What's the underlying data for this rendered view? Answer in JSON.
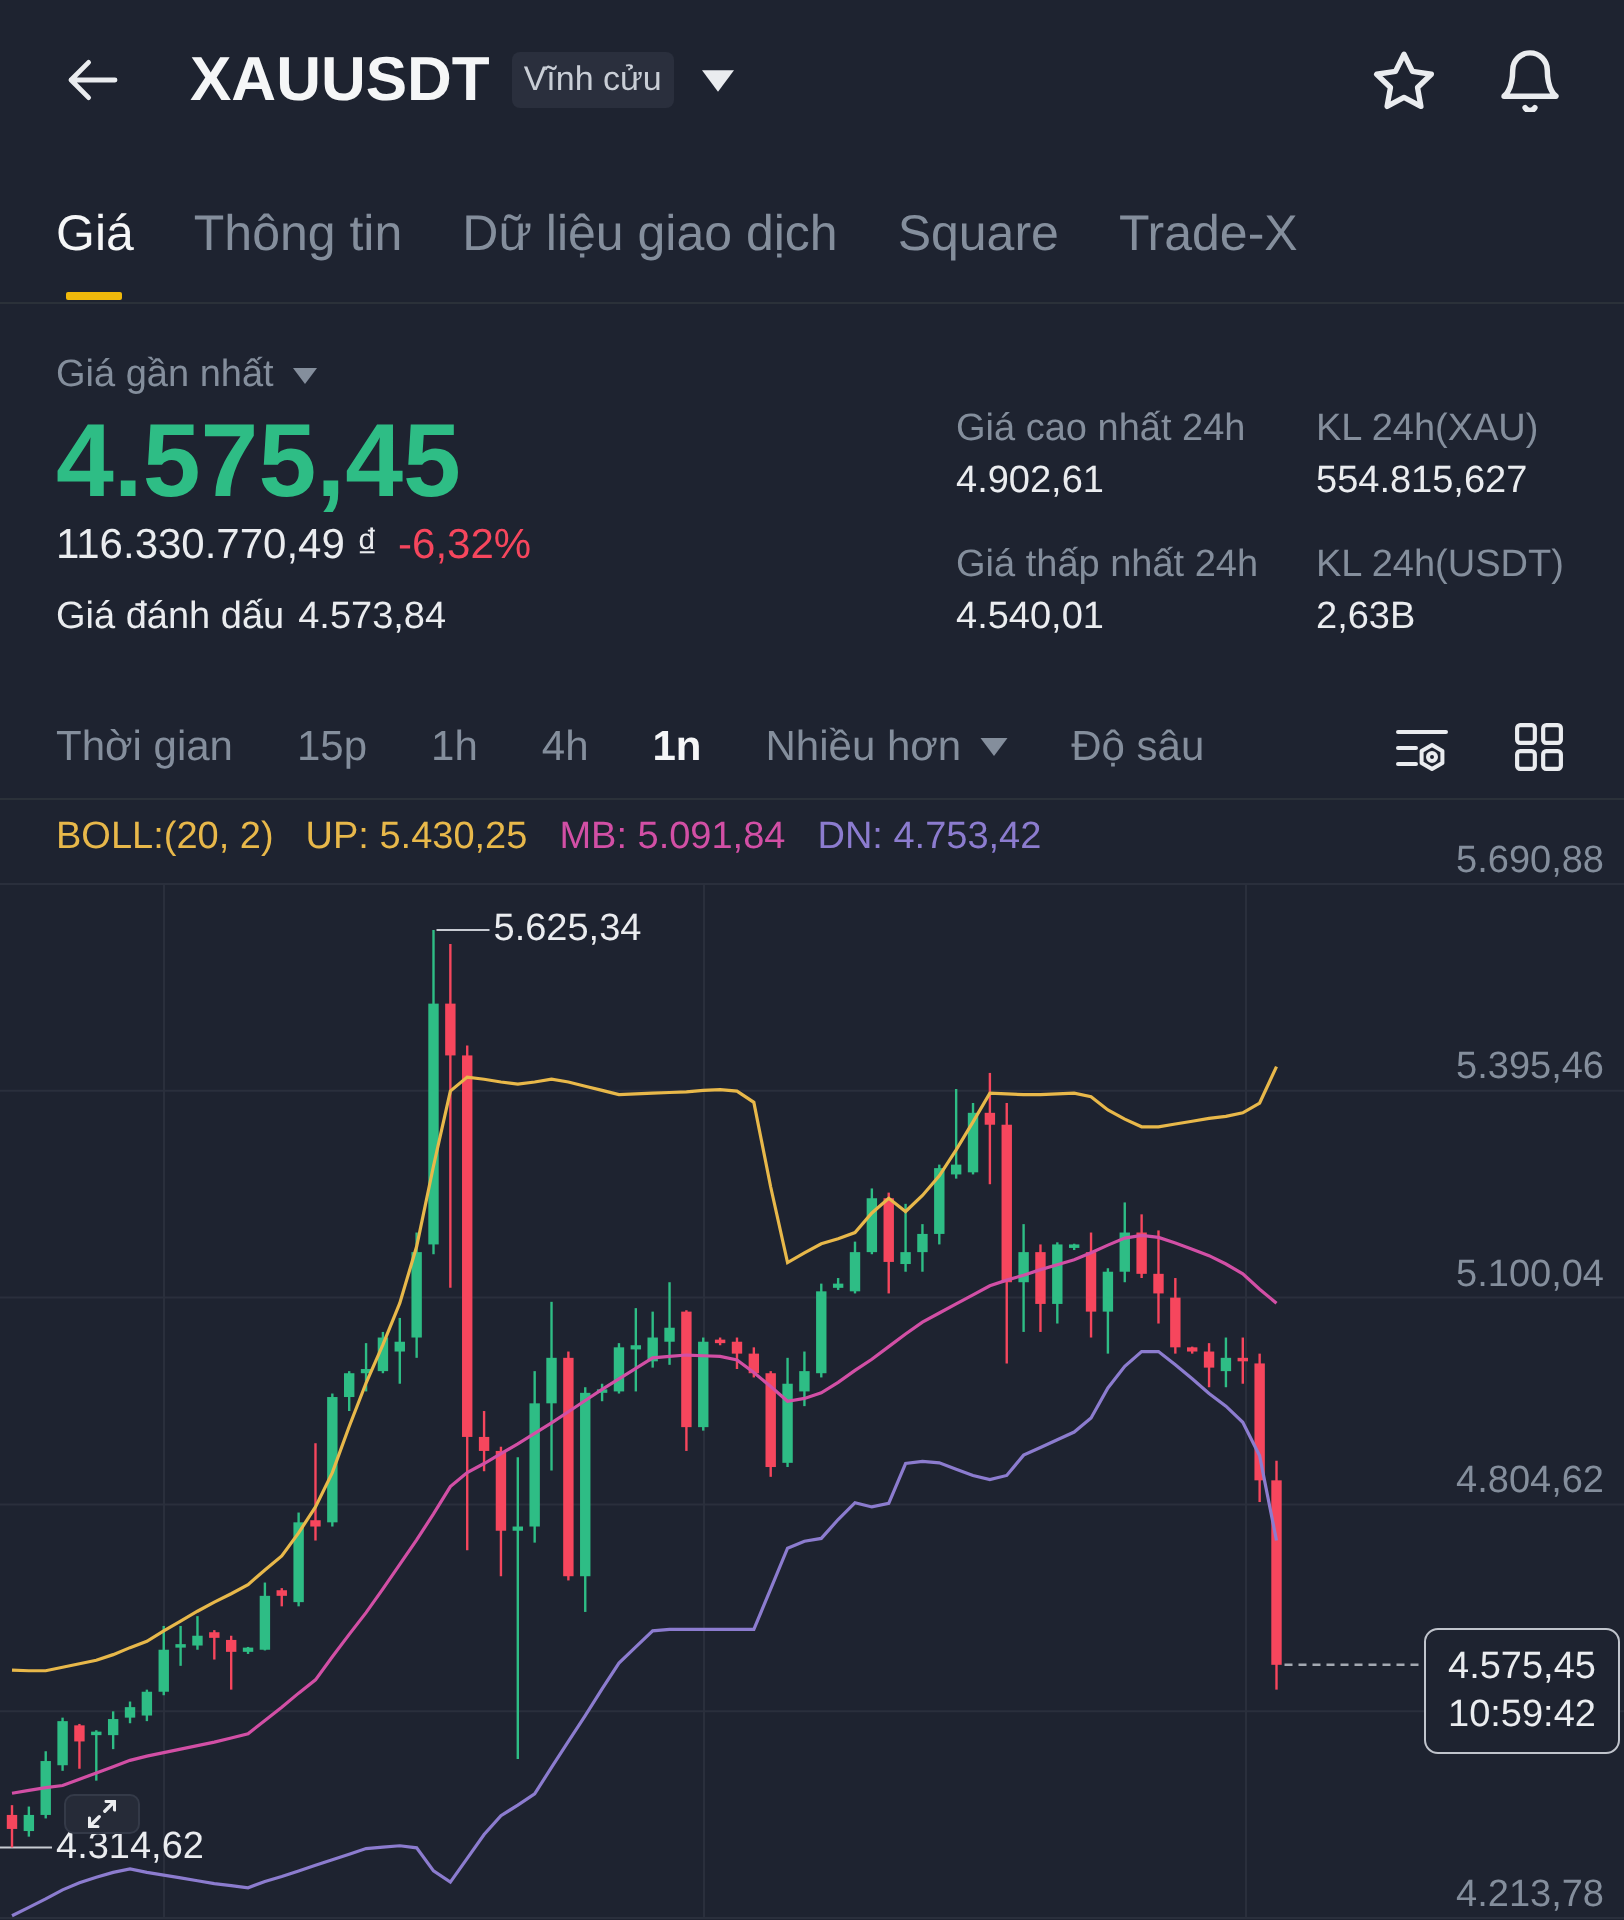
{
  "header": {
    "title": "XAUUSDT",
    "badge": "Vĩnh cửu"
  },
  "tabs": [
    {
      "label": "Giá",
      "selected": true
    },
    {
      "label": "Thông tin",
      "selected": false
    },
    {
      "label": "Dữ liệu giao dịch",
      "selected": false
    },
    {
      "label": "Square",
      "selected": false
    },
    {
      "label": "Trade-X",
      "selected": false
    }
  ],
  "price": {
    "label": "Giá gần nhất",
    "last": "4.575,45",
    "last_rising": true,
    "fiat": "116.330.770,49 ₫",
    "change": "-6,32%",
    "change_rising": false,
    "mark_label": "Giá đánh dấu",
    "mark_value": "4.573,84"
  },
  "stats": [
    {
      "label": "Giá cao nhất 24h",
      "value": "4.902,61"
    },
    {
      "label": "KL 24h(XAU)",
      "value": "554.815,627"
    },
    {
      "label": "Giá thấp nhất 24h",
      "value": "4.540,01"
    },
    {
      "label": "KL 24h(USDT)",
      "value": "2,63B"
    }
  ],
  "intervals": [
    {
      "label": "Thời gian",
      "selected": false,
      "kind": "option"
    },
    {
      "label": "15p",
      "selected": false,
      "kind": "option"
    },
    {
      "label": "1h",
      "selected": false,
      "kind": "option"
    },
    {
      "label": "4h",
      "selected": false,
      "kind": "option"
    },
    {
      "label": "1n",
      "selected": true,
      "kind": "option"
    },
    {
      "label": "Nhiều hơn",
      "selected": false,
      "kind": "menu"
    },
    {
      "label": "Độ sâu",
      "selected": false,
      "kind": "option"
    }
  ],
  "chart": {
    "indicator": "BOLL:(20, 2)",
    "high_label": "5.625,34",
    "low_label": "4.314,62",
    "last_price": "4.575,45",
    "last_time": "10:59:42",
    "chart_data": {
      "type": "candlestick",
      "grid": true,
      "ohlc": [
        [
          4361,
          4375,
          4314.62,
          4341
        ],
        [
          4338,
          4373,
          4330,
          4361
        ],
        [
          4361,
          4452,
          4356,
          4438
        ],
        [
          4432,
          4500,
          4424,
          4495
        ],
        [
          4489,
          4491,
          4427,
          4466
        ],
        [
          4475,
          4482,
          4410,
          4480
        ],
        [
          4475,
          4509,
          4455,
          4498
        ],
        [
          4500,
          4523,
          4492,
          4515
        ],
        [
          4503,
          4540,
          4495,
          4537
        ],
        [
          4537,
          4631,
          4532,
          4597
        ],
        [
          4600,
          4631,
          4574,
          4605
        ],
        [
          4603,
          4645,
          4597,
          4617
        ],
        [
          4622,
          4625,
          4583,
          4614
        ],
        [
          4611,
          4617,
          4540,
          4594
        ],
        [
          4594,
          4601,
          4591,
          4600
        ],
        [
          4597,
          4693,
          4596,
          4674
        ],
        [
          4682,
          4685,
          4659,
          4674
        ],
        [
          4665,
          4793,
          4659,
          4779
        ],
        [
          4782,
          4892,
          4753,
          4773
        ],
        [
          4779,
          4963,
          4773,
          4958
        ],
        [
          4958,
          4995,
          4938,
          4992
        ],
        [
          4992,
          5035,
          4966,
          4998
        ],
        [
          4995,
          5051,
          4992,
          5043
        ],
        [
          5023,
          5071,
          4977,
          5037
        ],
        [
          5043,
          5193,
          5014,
          5165
        ],
        [
          5176,
          5625.34,
          5162,
          5520
        ],
        [
          5520,
          5605,
          5114,
          5446
        ],
        [
          5446,
          5460,
          4739,
          4901
        ],
        [
          4901,
          4938,
          4852,
          4881
        ],
        [
          4881,
          4887,
          4702,
          4767
        ],
        [
          4767,
          4872,
          4441,
          4773
        ],
        [
          4773,
          4995,
          4750,
          4949
        ],
        [
          4949,
          5094,
          4853,
          5014
        ],
        [
          5014,
          5023,
          4696,
          4702
        ],
        [
          4702,
          4972,
          4651,
          4964
        ],
        [
          4964,
          4977,
          4952,
          4969
        ],
        [
          4966,
          5035,
          4963,
          5029
        ],
        [
          5026,
          5085,
          4966,
          5032
        ],
        [
          5009,
          5080,
          5000,
          5043
        ],
        [
          5037,
          5122,
          5004,
          5057
        ],
        [
          5080,
          5082,
          4881,
          4915
        ],
        [
          4915,
          5043,
          4910,
          5037
        ],
        [
          5040,
          5043,
          5032,
          5035
        ],
        [
          5037,
          5043,
          4998,
          5020
        ],
        [
          5020,
          5029,
          4986,
          4992
        ],
        [
          4992,
          4995,
          4844,
          4858
        ],
        [
          4864,
          5014,
          4858,
          4977
        ],
        [
          4966,
          5023,
          4945,
          4995
        ],
        [
          4992,
          5120,
          4986,
          5109
        ],
        [
          5114,
          5128,
          5111,
          5120
        ],
        [
          5109,
          5180,
          5106,
          5165
        ],
        [
          5165,
          5256,
          5162,
          5242
        ],
        [
          5242,
          5250,
          5106,
          5151
        ],
        [
          5148,
          5234,
          5137,
          5165
        ],
        [
          5165,
          5205,
          5137,
          5191
        ],
        [
          5191,
          5290,
          5176,
          5285
        ],
        [
          5276,
          5398,
          5270,
          5290
        ],
        [
          5279,
          5378,
          5276,
          5364
        ],
        [
          5364,
          5421,
          5262,
          5347
        ],
        [
          5347,
          5378,
          5006,
          5122
        ],
        [
          5122,
          5205,
          5051,
          5165
        ],
        [
          5165,
          5176,
          5051,
          5091
        ],
        [
          5091,
          5179,
          5063,
          5176
        ],
        [
          5171,
          5177,
          5168,
          5176
        ],
        [
          5165,
          5193,
          5043,
          5080
        ],
        [
          5080,
          5142,
          5020,
          5137
        ],
        [
          5137,
          5236,
          5122,
          5193
        ],
        [
          5193,
          5219,
          5128,
          5134
        ],
        [
          5134,
          5196,
          5063,
          5106
        ],
        [
          5100,
          5128,
          5020,
          5029
        ],
        [
          5029,
          5030,
          5020,
          5023
        ],
        [
          5023,
          5035,
          4972,
          5000
        ],
        [
          4995,
          5043,
          4972,
          5014
        ],
        [
          5014,
          5043,
          4977,
          5009
        ],
        [
          5006,
          5020,
          4808,
          4839
        ],
        [
          4839,
          4867,
          4540.01,
          4575.45
        ]
      ],
      "series": [
        {
          "name": "UP: 5.430,25",
          "type": "line",
          "color": "#e8b84a",
          "values": [
            4568,
            4567,
            4567,
            4572,
            4577,
            4582,
            4590,
            4600,
            4609,
            4624,
            4638,
            4652,
            4665,
            4677,
            4690,
            4711,
            4731,
            4764,
            4801,
            4850,
            4916,
            4978,
            5033,
            5092,
            5173,
            5288,
            5395,
            5415,
            5412,
            5408,
            5405,
            5408,
            5412,
            5408,
            5402,
            5396,
            5390,
            5391,
            5392,
            5393,
            5394,
            5396,
            5397,
            5395,
            5379,
            5258,
            5150,
            5164,
            5177,
            5184,
            5193,
            5221,
            5242,
            5223,
            5246,
            5274,
            5311,
            5351,
            5392,
            5391,
            5390,
            5390,
            5391,
            5392,
            5387,
            5368,
            5355,
            5344,
            5344,
            5348,
            5352,
            5356,
            5359,
            5364,
            5378,
            5430
          ]
        },
        {
          "name": "MB: 5.091,84",
          "type": "line",
          "color": "#d24fa5",
          "values": [
            4392,
            4396,
            4400,
            4403,
            4412,
            4421,
            4430,
            4439,
            4445,
            4450,
            4455,
            4460,
            4465,
            4471,
            4477,
            4496,
            4515,
            4535,
            4554,
            4587,
            4619,
            4650,
            4684,
            4719,
            4754,
            4791,
            4830,
            4850,
            4863,
            4877,
            4891,
            4906,
            4921,
            4937,
            4953,
            4969,
            4984,
            4999,
            5014,
            5016,
            5018,
            5017,
            5016,
            5011,
            4993,
            4973,
            4952,
            4956,
            4964,
            4979,
            4996,
            5012,
            5030,
            5048,
            5065,
            5078,
            5091,
            5104,
            5117,
            5125,
            5132,
            5140,
            5147,
            5154,
            5164,
            5175,
            5185,
            5189,
            5186,
            5178,
            5169,
            5160,
            5148,
            5134,
            5112,
            5092
          ]
        },
        {
          "name": "DN: 4.753,42",
          "type": "line",
          "color": "#8c7ccf",
          "values": [
            4217,
            4229,
            4241,
            4254,
            4264,
            4272,
            4279,
            4284,
            4279,
            4275,
            4271,
            4267,
            4263,
            4260,
            4257,
            4266,
            4273,
            4281,
            4289,
            4297,
            4305,
            4313,
            4315,
            4317,
            4314,
            4281,
            4265,
            4299,
            4333,
            4360,
            4375,
            4391,
            4429,
            4466,
            4503,
            4541,
            4578,
            4601,
            4624,
            4626,
            4626,
            4626,
            4626,
            4626,
            4626,
            4684,
            4742,
            4752,
            4756,
            4783,
            4807,
            4801,
            4806,
            4863,
            4866,
            4864,
            4855,
            4846,
            4840,
            4846,
            4875,
            4886,
            4897,
            4908,
            4928,
            4971,
            5002,
            5023,
            5023,
            5004,
            4984,
            4963,
            4945,
            4922,
            4874,
            4753
          ]
        }
      ],
      "ylim": [
        4213.78,
        5690.88
      ],
      "yticks": [
        {
          "value": 5690.88,
          "label": "5.690,88"
        },
        {
          "value": 5395.46,
          "label": "5.395,46"
        },
        {
          "value": 5100.04,
          "label": "5.100,04"
        },
        {
          "value": 4804.62,
          "label": "4.804,62"
        },
        {
          "value": 4213.78,
          "label": "4.213,78"
        }
      ]
    }
  }
}
